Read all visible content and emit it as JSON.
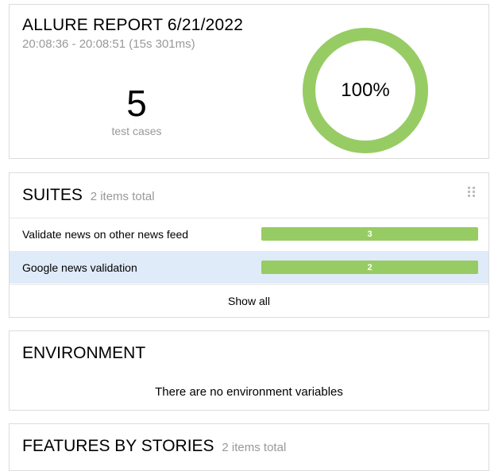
{
  "summary": {
    "title": "ALLURE REPORT 6/21/2022",
    "time_range": "20:08:36 - 20:08:51 (15s 301ms)",
    "test_count": "5",
    "test_count_label": "test cases",
    "success_rate": "100%",
    "success_fraction": 1.0
  },
  "suites": {
    "title": "SUITES",
    "subtitle": "2 items total",
    "items": [
      {
        "name": "Validate news on other news feed",
        "count": "3"
      },
      {
        "name": "Google news validation",
        "count": "2"
      }
    ],
    "show_all": "Show all"
  },
  "environment": {
    "title": "ENVIRONMENT",
    "empty_message": "There are no environment variables"
  },
  "features": {
    "title": "FEATURES BY STORIES",
    "subtitle": "2 items total"
  },
  "colors": {
    "passed": "#97cc64",
    "selected_row": "#e0ebfa",
    "muted_text": "#999999",
    "border": "#dcdcdc"
  }
}
